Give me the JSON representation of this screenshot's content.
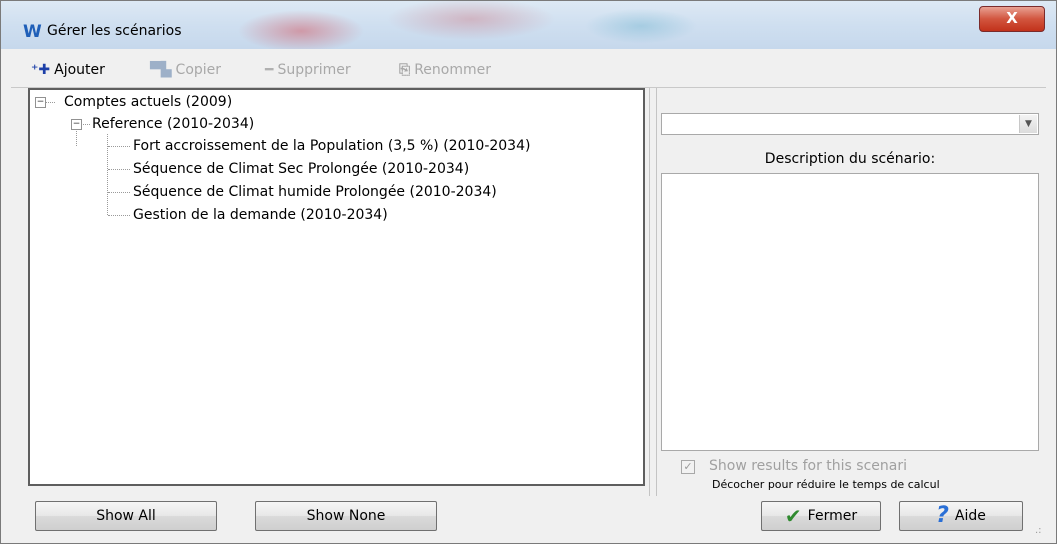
{
  "window": {
    "title": "Gérer les scénarios",
    "app_icon": "W",
    "close_label": "X"
  },
  "toolbar": {
    "add_label": "Ajouter",
    "copy_label": "Copier",
    "delete_label": "Supprimer",
    "rename_label": "Renommer"
  },
  "tree": {
    "root": "Comptes actuels (2009)",
    "reference": "Reference (2010-2034)",
    "scenarios": [
      "Fort accroissement de la Population (3,5 %) (2010-2034)",
      "Séquence de Climat Sec Prolongée (2010-2034)",
      "Séquence de Climat humide Prolongée (2010-2034)",
      "Gestion de la demande (2010-2034)"
    ]
  },
  "right_panel": {
    "dropdown_value": "",
    "description_label": "Description du scénario:",
    "description_text": "",
    "show_results_label": "Show results for this scenari",
    "show_results_checked": true,
    "hint": "Décocher pour réduire le temps de calcul"
  },
  "buttons": {
    "show_all": "Show All",
    "show_none": "Show None",
    "close": "Fermer",
    "help": "Aide"
  }
}
